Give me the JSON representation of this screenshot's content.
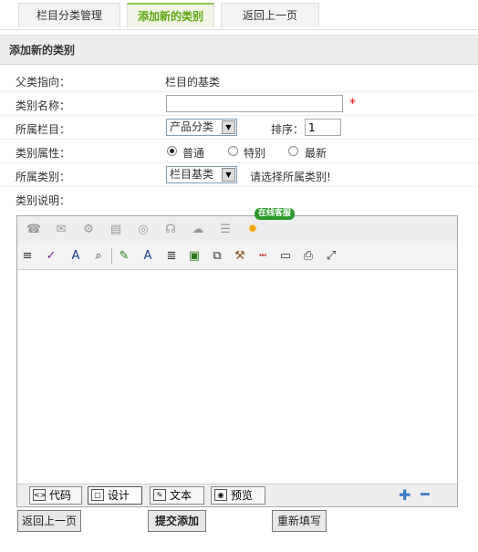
{
  "tabs": [
    {
      "label": "栏目分类管理"
    },
    {
      "label": "添加新的类别"
    },
    {
      "label": "返回上一页"
    }
  ],
  "panel_title": "添加新的类别",
  "form": {
    "parent": {
      "label": "父类指向：",
      "value": "栏目的基类"
    },
    "name": {
      "label": "类别名称：",
      "value": "",
      "required_mark": "*"
    },
    "column": {
      "label": "所属栏目：",
      "selected": "产品分类",
      "sort_label": "排序：",
      "sort_value": "1"
    },
    "attr": {
      "label": "类别属性：",
      "options": [
        "普通",
        "特别",
        "最新"
      ],
      "selected_index": 0
    },
    "category": {
      "label": "所属类别：",
      "selected": "栏目基类",
      "hint": "请选择所属类别!"
    },
    "desc": {
      "label": "类别说明："
    }
  },
  "editor": {
    "service_badge": "在线客服",
    "modes": [
      "代码",
      "设计",
      "文本",
      "预览"
    ],
    "active_mode": "设计"
  },
  "buttons": {
    "back": "返回上一页",
    "submit": "提交添加",
    "reset": "重新填写"
  }
}
